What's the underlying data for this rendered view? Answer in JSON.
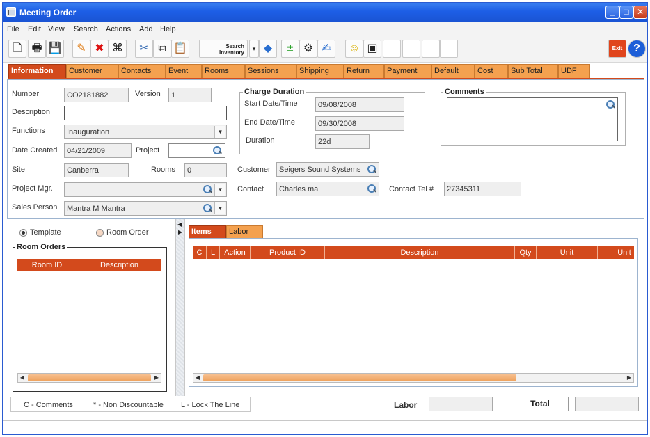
{
  "window": {
    "title": "Meeting Order"
  },
  "menu": [
    "File",
    "Edit",
    "View",
    "Search",
    "Actions",
    "Add",
    "Help"
  ],
  "toolbar": {
    "search_inventory_line1": "Search",
    "search_inventory_line2": "Inventory",
    "exit_label": "Exit"
  },
  "tabs": [
    "Information",
    "Customer",
    "Contacts",
    "Event",
    "Rooms",
    "Sessions",
    "Shipping",
    "Return",
    "Payment",
    "Default",
    "Cost",
    "Sub Total",
    "UDF"
  ],
  "info": {
    "number_label": "Number",
    "number_value": "CO2181882",
    "version_label": "Version",
    "version_value": "1",
    "description_label": "Description",
    "description_value": "",
    "functions_label": "Functions",
    "functions_value": "Inauguration",
    "date_created_label": "Date Created",
    "date_created_value": "04/21/2009",
    "project_label": "Project",
    "project_value": "",
    "site_label": "Site",
    "site_value": "Canberra",
    "rooms_label": "Rooms",
    "rooms_value": "0",
    "project_mgr_label": "Project Mgr.",
    "project_mgr_value": "",
    "sales_person_label": "Sales Person",
    "sales_person_value": "Mantra M Mantra"
  },
  "charge_duration": {
    "title": "Charge Duration",
    "start_label": "Start Date/Time",
    "start_value": "09/08/2008",
    "end_label": "End Date/Time",
    "end_value": "09/30/2008",
    "duration_label": "Duration",
    "duration_value": "22d"
  },
  "customer": {
    "customer_label": "Customer",
    "customer_value": "Seigers Sound Systems",
    "contact_label": "Contact",
    "contact_value": "Charles mal",
    "contact_tel_label": "Contact Tel #",
    "contact_tel_value": "27345311"
  },
  "comments": {
    "title": "Comments",
    "value": ""
  },
  "room_orders": {
    "radio_template": "Template",
    "radio_room_order": "Room Order",
    "title": "Room Orders",
    "columns": [
      "Room ID",
      "Description"
    ]
  },
  "items_panel": {
    "tabs": [
      "Items",
      "Labor"
    ],
    "columns": [
      "C",
      "L",
      "Action",
      "Product ID",
      "Description",
      "Qty",
      "Unit",
      "Unit"
    ]
  },
  "legend": {
    "c": "C - Comments",
    "star": "* - Non Discountable",
    "l": "L - Lock The Line"
  },
  "totals": {
    "labor_label": "Labor",
    "labor_value": "",
    "total_label": "Total",
    "total_value": ""
  },
  "colors": {
    "accent": "#d34a1c",
    "tab": "#f4a14f",
    "titlebar": "#1d5ee6"
  }
}
